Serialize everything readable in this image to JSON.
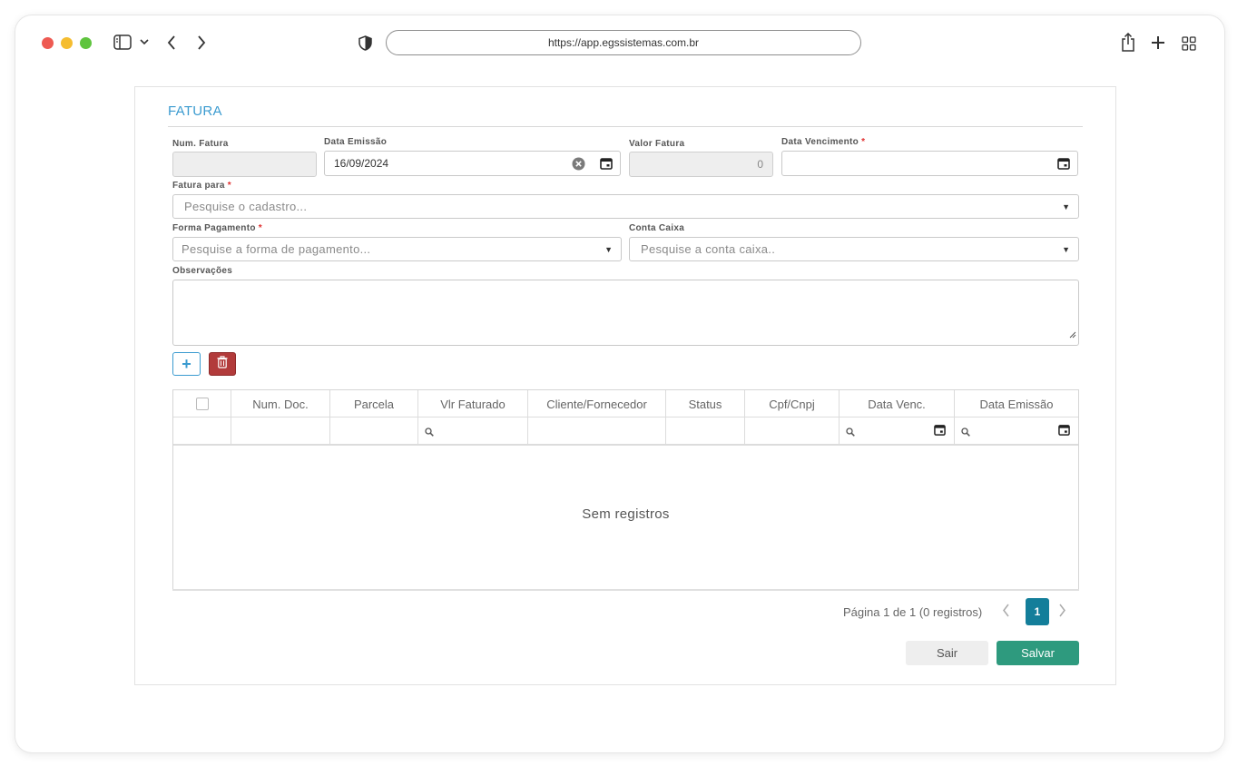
{
  "browser": {
    "url": "https://app.egssistemas.com.br"
  },
  "form": {
    "title": "FATURA",
    "num_fatura": {
      "label": "Num. Fatura",
      "value": ""
    },
    "data_emissao": {
      "label": "Data Emissão",
      "value": "16/09/2024"
    },
    "valor_fatura": {
      "label": "Valor Fatura",
      "value": "0"
    },
    "data_vencimento": {
      "label": "Data Vencimento",
      "required_mark": "*",
      "value": ""
    },
    "fatura_para": {
      "label": "Fatura para",
      "required_mark": "*",
      "placeholder": "Pesquise o cadastro..."
    },
    "forma_pagamento": {
      "label": "Forma Pagamento",
      "required_mark": "*",
      "placeholder": "Pesquise a forma de pagamento..."
    },
    "conta_caixa": {
      "label": "Conta Caixa",
      "placeholder": "Pesquise a conta caixa.."
    },
    "observacoes": {
      "label": "Observações",
      "value": ""
    },
    "add_button": "+"
  },
  "grid": {
    "columns": [
      "Num. Doc.",
      "Parcela",
      "Vlr Faturado",
      "Cliente/Fornecedor",
      "Status",
      "Cpf/Cnpj",
      "Data Venc.",
      "Data Emissão"
    ],
    "empty_text": "Sem registros",
    "rows": []
  },
  "pager": {
    "info": "Página 1 de 1 (0 registros)",
    "current_page": "1"
  },
  "actions": {
    "sair": "Sair",
    "salvar": "Salvar"
  },
  "colors": {
    "accent": "#3b9bd0",
    "pager_active": "#137e9a",
    "save": "#2e9a7e",
    "delete": "#b23b3b",
    "required": "#e03030"
  }
}
